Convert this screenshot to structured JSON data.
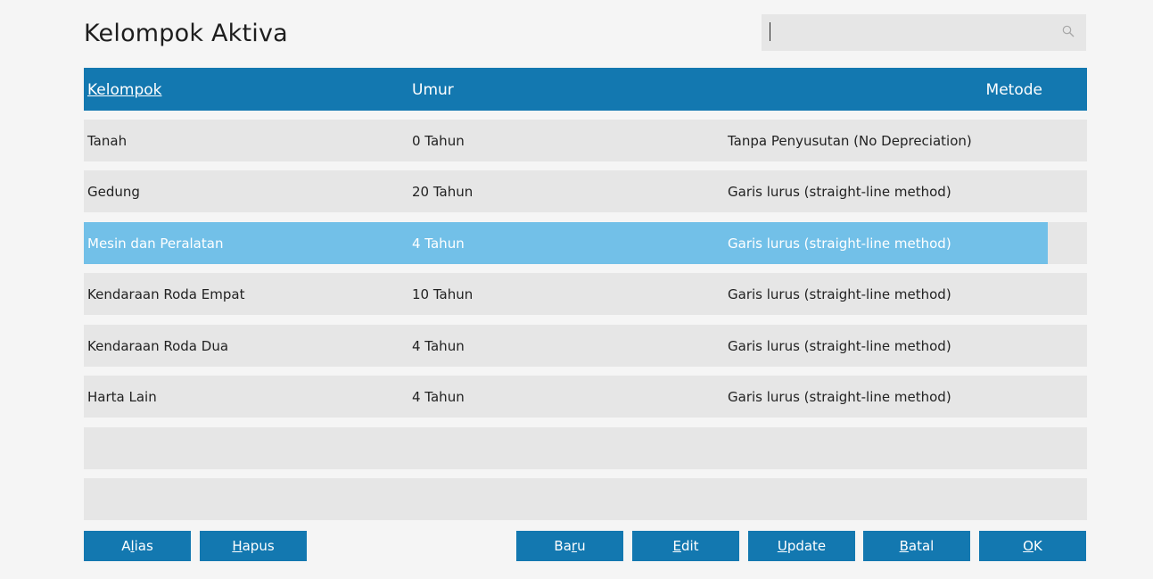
{
  "window": {
    "title": "Kelompok Aktiva"
  },
  "search": {
    "value": "",
    "icon": "search-icon"
  },
  "table": {
    "columns": [
      {
        "label": "Kelompok"
      },
      {
        "label": "Umur"
      },
      {
        "label": "Metode"
      }
    ],
    "rows": [
      {
        "kelompok": "Tanah",
        "umur": "0 Tahun",
        "metode": "Tanpa Penyusutan (No Depreciation)",
        "selected": false
      },
      {
        "kelompok": "Gedung",
        "umur": "20 Tahun",
        "metode": "Garis lurus (straight-line method)",
        "selected": false
      },
      {
        "kelompok": "Mesin dan Peralatan",
        "umur": "4 Tahun",
        "metode": "Garis lurus (straight-line method)",
        "selected": true
      },
      {
        "kelompok": "Kendaraan Roda Empat",
        "umur": "10 Tahun",
        "metode": "Garis lurus (straight-line method)",
        "selected": false
      },
      {
        "kelompok": "Kendaraan Roda Dua",
        "umur": "4 Tahun",
        "metode": "Garis lurus (straight-line method)",
        "selected": false
      },
      {
        "kelompok": "Harta Lain",
        "umur": "4 Tahun",
        "metode": "Garis lurus (straight-line method)",
        "selected": false
      },
      {
        "kelompok": "",
        "umur": "",
        "metode": "",
        "selected": false
      },
      {
        "kelompok": "",
        "umur": "",
        "metode": "",
        "selected": false
      }
    ]
  },
  "buttons": {
    "alias": {
      "pre": "A",
      "mn": "l",
      "post": "ias"
    },
    "hapus": {
      "pre": "",
      "mn": "H",
      "post": "apus"
    },
    "baru": {
      "pre": "Ba",
      "mn": "r",
      "post": "u"
    },
    "edit": {
      "pre": "",
      "mn": "E",
      "post": "dit"
    },
    "update": {
      "pre": "",
      "mn": "U",
      "post": "pdate"
    },
    "batal": {
      "pre": "",
      "mn": "B",
      "post": "atal"
    },
    "ok": {
      "pre": "",
      "mn": "O",
      "post": "K"
    }
  },
  "colors": {
    "accent": "#1378b0",
    "selected_row": "#72c0e8",
    "row_bg": "#e6e6e6",
    "page_bg": "#f5f5f5"
  }
}
